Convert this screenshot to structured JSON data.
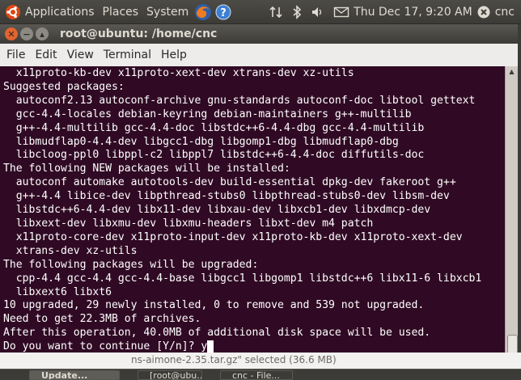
{
  "top_panel": {
    "menus": [
      "Applications",
      "Places",
      "System"
    ],
    "clock": "Thu Dec 17,  9:20 AM",
    "user": "cnc",
    "icons": [
      "ubuntu-logo-icon",
      "firefox-icon",
      "help-icon",
      "network-icon",
      "bluetooth-icon",
      "volume-icon",
      "mail-icon",
      "session-icon"
    ]
  },
  "window": {
    "title": "root@ubuntu: /home/cnc",
    "menus": [
      "File",
      "Edit",
      "View",
      "Terminal",
      "Help"
    ]
  },
  "terminal": {
    "lines": [
      "  x11proto-kb-dev x11proto-xext-dev xtrans-dev xz-utils",
      "Suggested packages:",
      "  autoconf2.13 autoconf-archive gnu-standards autoconf-doc libtool gettext",
      "  gcc-4.4-locales debian-keyring debian-maintainers g++-multilib",
      "  g++-4.4-multilib gcc-4.4-doc libstdc++6-4.4-dbg gcc-4.4-multilib",
      "  libmudflap0-4.4-dev libgcc1-dbg libgomp1-dbg libmudflap0-dbg",
      "  libcloog-ppl0 libppl-c2 libppl7 libstdc++6-4.4-doc diffutils-doc",
      "The following NEW packages will be installed:",
      "  autoconf automake autotools-dev build-essential dpkg-dev fakeroot g++",
      "  g++-4.4 libice-dev libpthread-stubs0 libpthread-stubs0-dev libsm-dev",
      "  libstdc++6-4.4-dev libx11-dev libxau-dev libxcb1-dev libxdmcp-dev",
      "  libxext-dev libxmu-dev libxmu-headers libxt-dev m4 patch",
      "  x11proto-core-dev x11proto-input-dev x11proto-kb-dev x11proto-xext-dev",
      "  xtrans-dev xz-utils",
      "The following packages will be upgraded:",
      "  cpp-4.4 gcc-4.4 gcc-4.4-base libgcc1 libgomp1 libstdc++6 libx11-6 libxcb1",
      "  libxext6 libxt6",
      "10 upgraded, 29 newly installed, 0 to remove and 539 not upgraded.",
      "Need to get 22.3MB of archives.",
      "After this operation, 40.0MB of additional disk space will be used.",
      "Do you want to continue [Y/n]? "
    ],
    "input": "y"
  },
  "background_window": {
    "partial_text": "ns-aimone-2.35.tar.gz\" selected (36.6 MB)"
  },
  "taskbar": {
    "tasks": [
      "Update...",
      "[root@ubu...",
      "cnc - File..."
    ]
  }
}
